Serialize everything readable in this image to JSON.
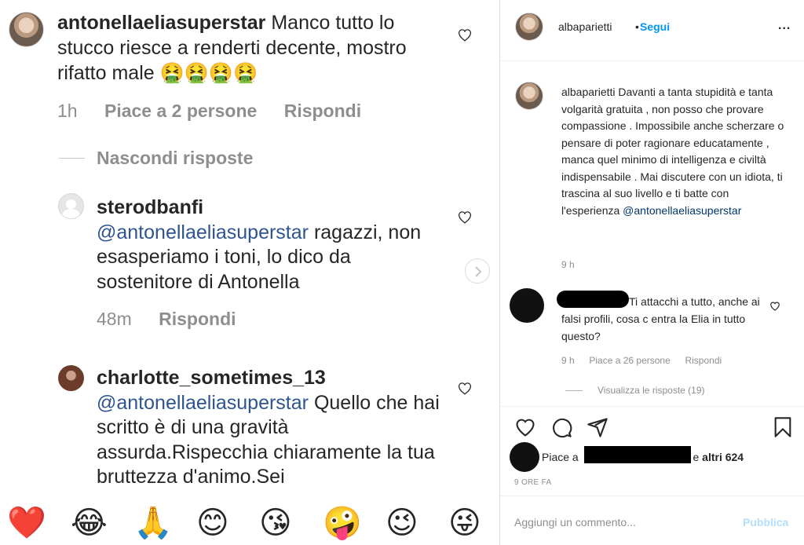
{
  "left": {
    "comments": [
      {
        "username": "antonellaeliasuperstar",
        "text": "Manco tutto lo stucco riesce a renderti decente, mostro rifatto male",
        "emojis": "🤮🤮🤮🤮",
        "time": "1h",
        "likes": "Piace a 2 persone",
        "reply": "Rispondi"
      },
      {
        "username": "sterodbanfi",
        "mention": "@antonellaeliasuperstar",
        "text": "ragazzi, non esasperiamo i toni, lo dico da sostenitore di Antonella",
        "time": "48m",
        "reply": "Rispondi"
      },
      {
        "username": "charlotte_sometimes_13",
        "mention": "@antonellaeliasuperstar",
        "text": "Quello che hai scritto è di una gravità assurda.Rispecchia chiaramente la tua bruttezza d'animo.Sei"
      }
    ],
    "hide_replies": "Nascondi risposte",
    "emoji_bar": [
      "❤️",
      "😂",
      "🙏",
      "😊",
      "😘",
      "🤪",
      "😉",
      "😜"
    ]
  },
  "right": {
    "header": {
      "username": "albaparietti",
      "dot": "•",
      "follow": "Segui",
      "more": "..."
    },
    "caption": {
      "username": "albaparietti",
      "text": "Davanti a tanta stupidità e tanta volgarità gratuita , non posso che provare compassione . Impossibile anche scherzare o pensare di poter ragionare educatamente , manca quel minimo di intelligenza e civiltà indispensabile . Mai discutere con un idiota, ti trascina al suo livello e ti batte con l'esperienza",
      "mention": "@antonellaeliasuperstar",
      "time": "9 h"
    },
    "comment": {
      "text": "Ti attacchi a tutto, anche ai falsi profili, cosa c entra la Elia in tutto questo?",
      "time": "9 h",
      "likes": "Piace a 26 persone",
      "reply": "Rispondi",
      "view_replies": "Visualizza le risposte (19)"
    },
    "likes": {
      "prefix": "Piace a",
      "suffix": "e",
      "others": "altri 624"
    },
    "time_ago": "9 ORE FA",
    "add_comment_placeholder": "Aggiungi un commento...",
    "publish": "Pubblica"
  },
  "colors": {
    "text": "#262626",
    "muted": "#8e8e8e",
    "link": "#0095f6",
    "mention_dark": "#00376b",
    "mention_mobile": "#2e5590",
    "publish_disabled": "#b2dffc"
  }
}
